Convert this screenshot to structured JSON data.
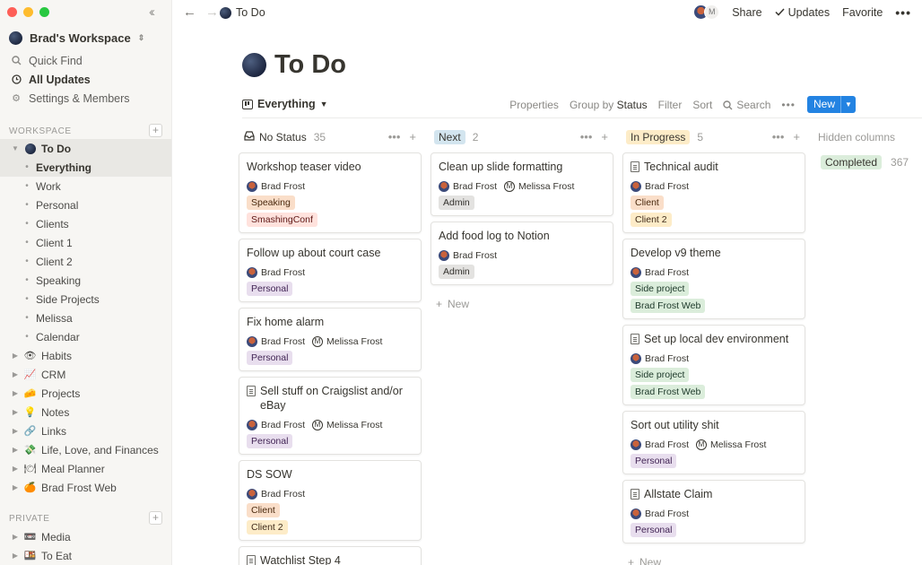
{
  "window": {
    "title": "To Do"
  },
  "sidebar": {
    "workspace_name": "Brad's Workspace",
    "top_links": [
      {
        "label": "Quick Find",
        "icon": "search-icon"
      },
      {
        "label": "All Updates",
        "icon": "clock-icon"
      },
      {
        "label": "Settings & Members",
        "icon": "gear-icon"
      }
    ],
    "workspace_label": "WORKSPACE",
    "private_label": "PRIVATE",
    "todo_label": "To Do",
    "todo_children": [
      "Everything",
      "Work",
      "Personal",
      "Clients",
      "Client 1",
      "Client 2",
      "Speaking",
      "Side Projects",
      "Melissa",
      "Calendar"
    ],
    "pages": [
      {
        "label": "Habits",
        "emoji": "👁"
      },
      {
        "label": "CRM",
        "emoji": "📈"
      },
      {
        "label": "Projects",
        "emoji": "🧀"
      },
      {
        "label": "Notes",
        "emoji": "💡"
      },
      {
        "label": "Links",
        "emoji": "🔗"
      },
      {
        "label": "Life, Love, and Finances",
        "emoji": "💸"
      },
      {
        "label": "Meal Planner",
        "emoji": "🍽"
      },
      {
        "label": "Brad Frost Web",
        "emoji": "🍊"
      }
    ],
    "private_pages": [
      {
        "label": "Media",
        "emoji": "📼"
      },
      {
        "label": "To Eat",
        "emoji": "🍱"
      }
    ]
  },
  "topbar": {
    "breadcrumb": "To Do",
    "share": "Share",
    "updates": "Updates",
    "favorite": "Favorite"
  },
  "page": {
    "title": "To Do"
  },
  "view": {
    "name": "Everything",
    "properties": "Properties",
    "group_by_prefix": "Group by",
    "group_by_value": "Status",
    "filter": "Filter",
    "sort": "Sort",
    "search": "Search",
    "new": "New"
  },
  "columns": [
    {
      "name": "No Status",
      "count": "35",
      "cards": [
        {
          "title": "Workshop teaser video",
          "doc": false,
          "people": [
            "Brad Frost"
          ],
          "tags": [
            {
              "label": "Speaking",
              "bg": "#fadec9",
              "fg": "#49290e"
            },
            {
              "label": "SmashingConf",
              "bg": "#ffe2dd",
              "fg": "#5d1715"
            }
          ]
        },
        {
          "title": "Follow up about court case",
          "doc": false,
          "people": [
            "Brad Frost"
          ],
          "tags": [
            {
              "label": "Personal",
              "bg": "#e8deee",
              "fg": "#412454"
            }
          ]
        },
        {
          "title": "Fix home alarm",
          "doc": false,
          "people": [
            "Brad Frost",
            "Melissa Frost"
          ],
          "tags": [
            {
              "label": "Personal",
              "bg": "#e8deee",
              "fg": "#412454"
            }
          ]
        },
        {
          "title": "Sell stuff on Craigslist and/or eBay",
          "doc": true,
          "people": [
            "Brad Frost",
            "Melissa Frost"
          ],
          "tags": [
            {
              "label": "Personal",
              "bg": "#e8deee",
              "fg": "#412454"
            }
          ]
        },
        {
          "title": "DS SOW",
          "doc": false,
          "people": [
            "Brad Frost"
          ],
          "tags": [
            {
              "label": "Client",
              "bg": "#fadec9",
              "fg": "#49290e"
            },
            {
              "label": "Client 2",
              "bg": "#fdecc8",
              "fg": "#402c1b"
            }
          ]
        },
        {
          "title": "Watchlist Step 4",
          "doc": true,
          "people": [],
          "tags": []
        }
      ]
    },
    {
      "name": "Next",
      "count": "2",
      "cards": [
        {
          "title": "Clean up slide formatting",
          "doc": false,
          "people": [
            "Brad Frost",
            "Melissa Frost"
          ],
          "tags": [
            {
              "label": "Admin",
              "bg": "#e3e2e0",
              "fg": "#32302c"
            }
          ]
        },
        {
          "title": "Add food log to Notion",
          "doc": false,
          "people": [
            "Brad Frost"
          ],
          "tags": [
            {
              "label": "Admin",
              "bg": "#e3e2e0",
              "fg": "#32302c"
            }
          ]
        }
      ],
      "new_label": "New"
    },
    {
      "name": "In Progress",
      "count": "5",
      "cards": [
        {
          "title": "Technical audit",
          "doc": true,
          "people": [
            "Brad Frost"
          ],
          "tags": [
            {
              "label": "Client",
              "bg": "#fadec9",
              "fg": "#49290e"
            },
            {
              "label": "Client 2",
              "bg": "#fdecc8",
              "fg": "#402c1b"
            }
          ]
        },
        {
          "title": "Develop v9 theme",
          "doc": false,
          "people": [
            "Brad Frost"
          ],
          "tags": [
            {
              "label": "Side project",
              "bg": "#dbeddb",
              "fg": "#1c3829"
            },
            {
              "label": "Brad Frost Web",
              "bg": "#dbeddb",
              "fg": "#1c3829"
            }
          ]
        },
        {
          "title": "Set up local dev environment",
          "doc": true,
          "people": [
            "Brad Frost"
          ],
          "tags": [
            {
              "label": "Side project",
              "bg": "#dbeddb",
              "fg": "#1c3829"
            },
            {
              "label": "Brad Frost Web",
              "bg": "#dbeddb",
              "fg": "#1c3829"
            }
          ]
        },
        {
          "title": "Sort out utility shit",
          "doc": false,
          "people": [
            "Brad Frost",
            "Melissa Frost"
          ],
          "tags": [
            {
              "label": "Personal",
              "bg": "#e8deee",
              "fg": "#412454"
            }
          ]
        },
        {
          "title": "Allstate Claim",
          "doc": true,
          "people": [
            "Brad Frost"
          ],
          "tags": [
            {
              "label": "Personal",
              "bg": "#e8deee",
              "fg": "#412454"
            }
          ]
        }
      ],
      "new_label": "New"
    }
  ],
  "hidden_columns": {
    "label": "Hidden columns",
    "items": [
      {
        "name": "Completed",
        "count": "367"
      }
    ]
  },
  "colors": {
    "next_pill": "#d3e5ef",
    "in_progress_pill": "#fdecc8",
    "completed_pill": "#dbeddb",
    "accent": "#2383e2"
  }
}
